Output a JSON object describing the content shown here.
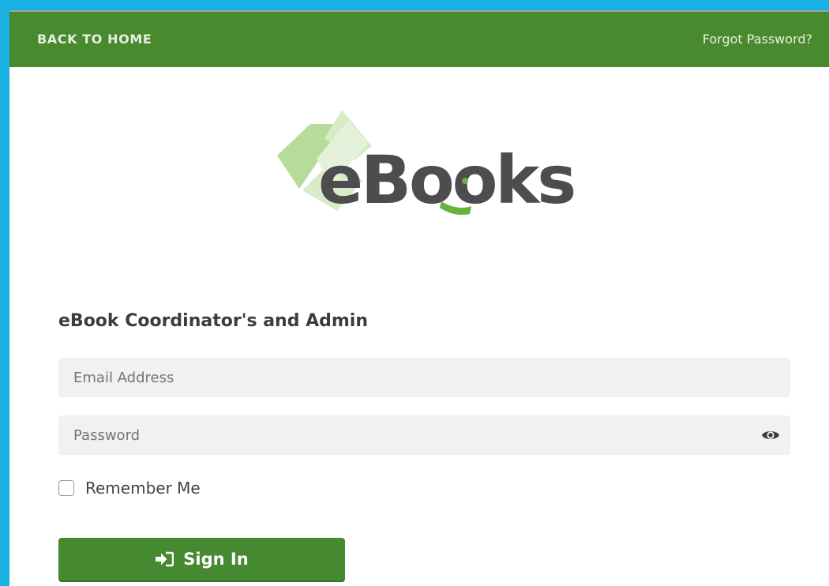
{
  "nav": {
    "back_label": "BACK TO HOME",
    "forgot_label": "Forgot Password?"
  },
  "logo": {
    "text": "eBooks",
    "colors": {
      "text": "#4d4d4f",
      "accent": "#6ab23e",
      "shape_light": "#d8ecc8",
      "shape_mid": "#b7dc9a"
    }
  },
  "form": {
    "title": "eBook Coordinator's and Admin",
    "email": {
      "placeholder": "Email Address",
      "value": ""
    },
    "password": {
      "placeholder": "Password",
      "value": "",
      "toggle_icon": "eye-icon"
    },
    "remember": {
      "label": "Remember Me",
      "checked": false
    },
    "submit": {
      "label": "Sign In",
      "icon": "sign-in-icon"
    }
  },
  "colors": {
    "frame": "#1ab0e4",
    "nav_bg": "#4a8a2f",
    "button_bg": "#458930",
    "input_bg": "#f1f1f1"
  }
}
